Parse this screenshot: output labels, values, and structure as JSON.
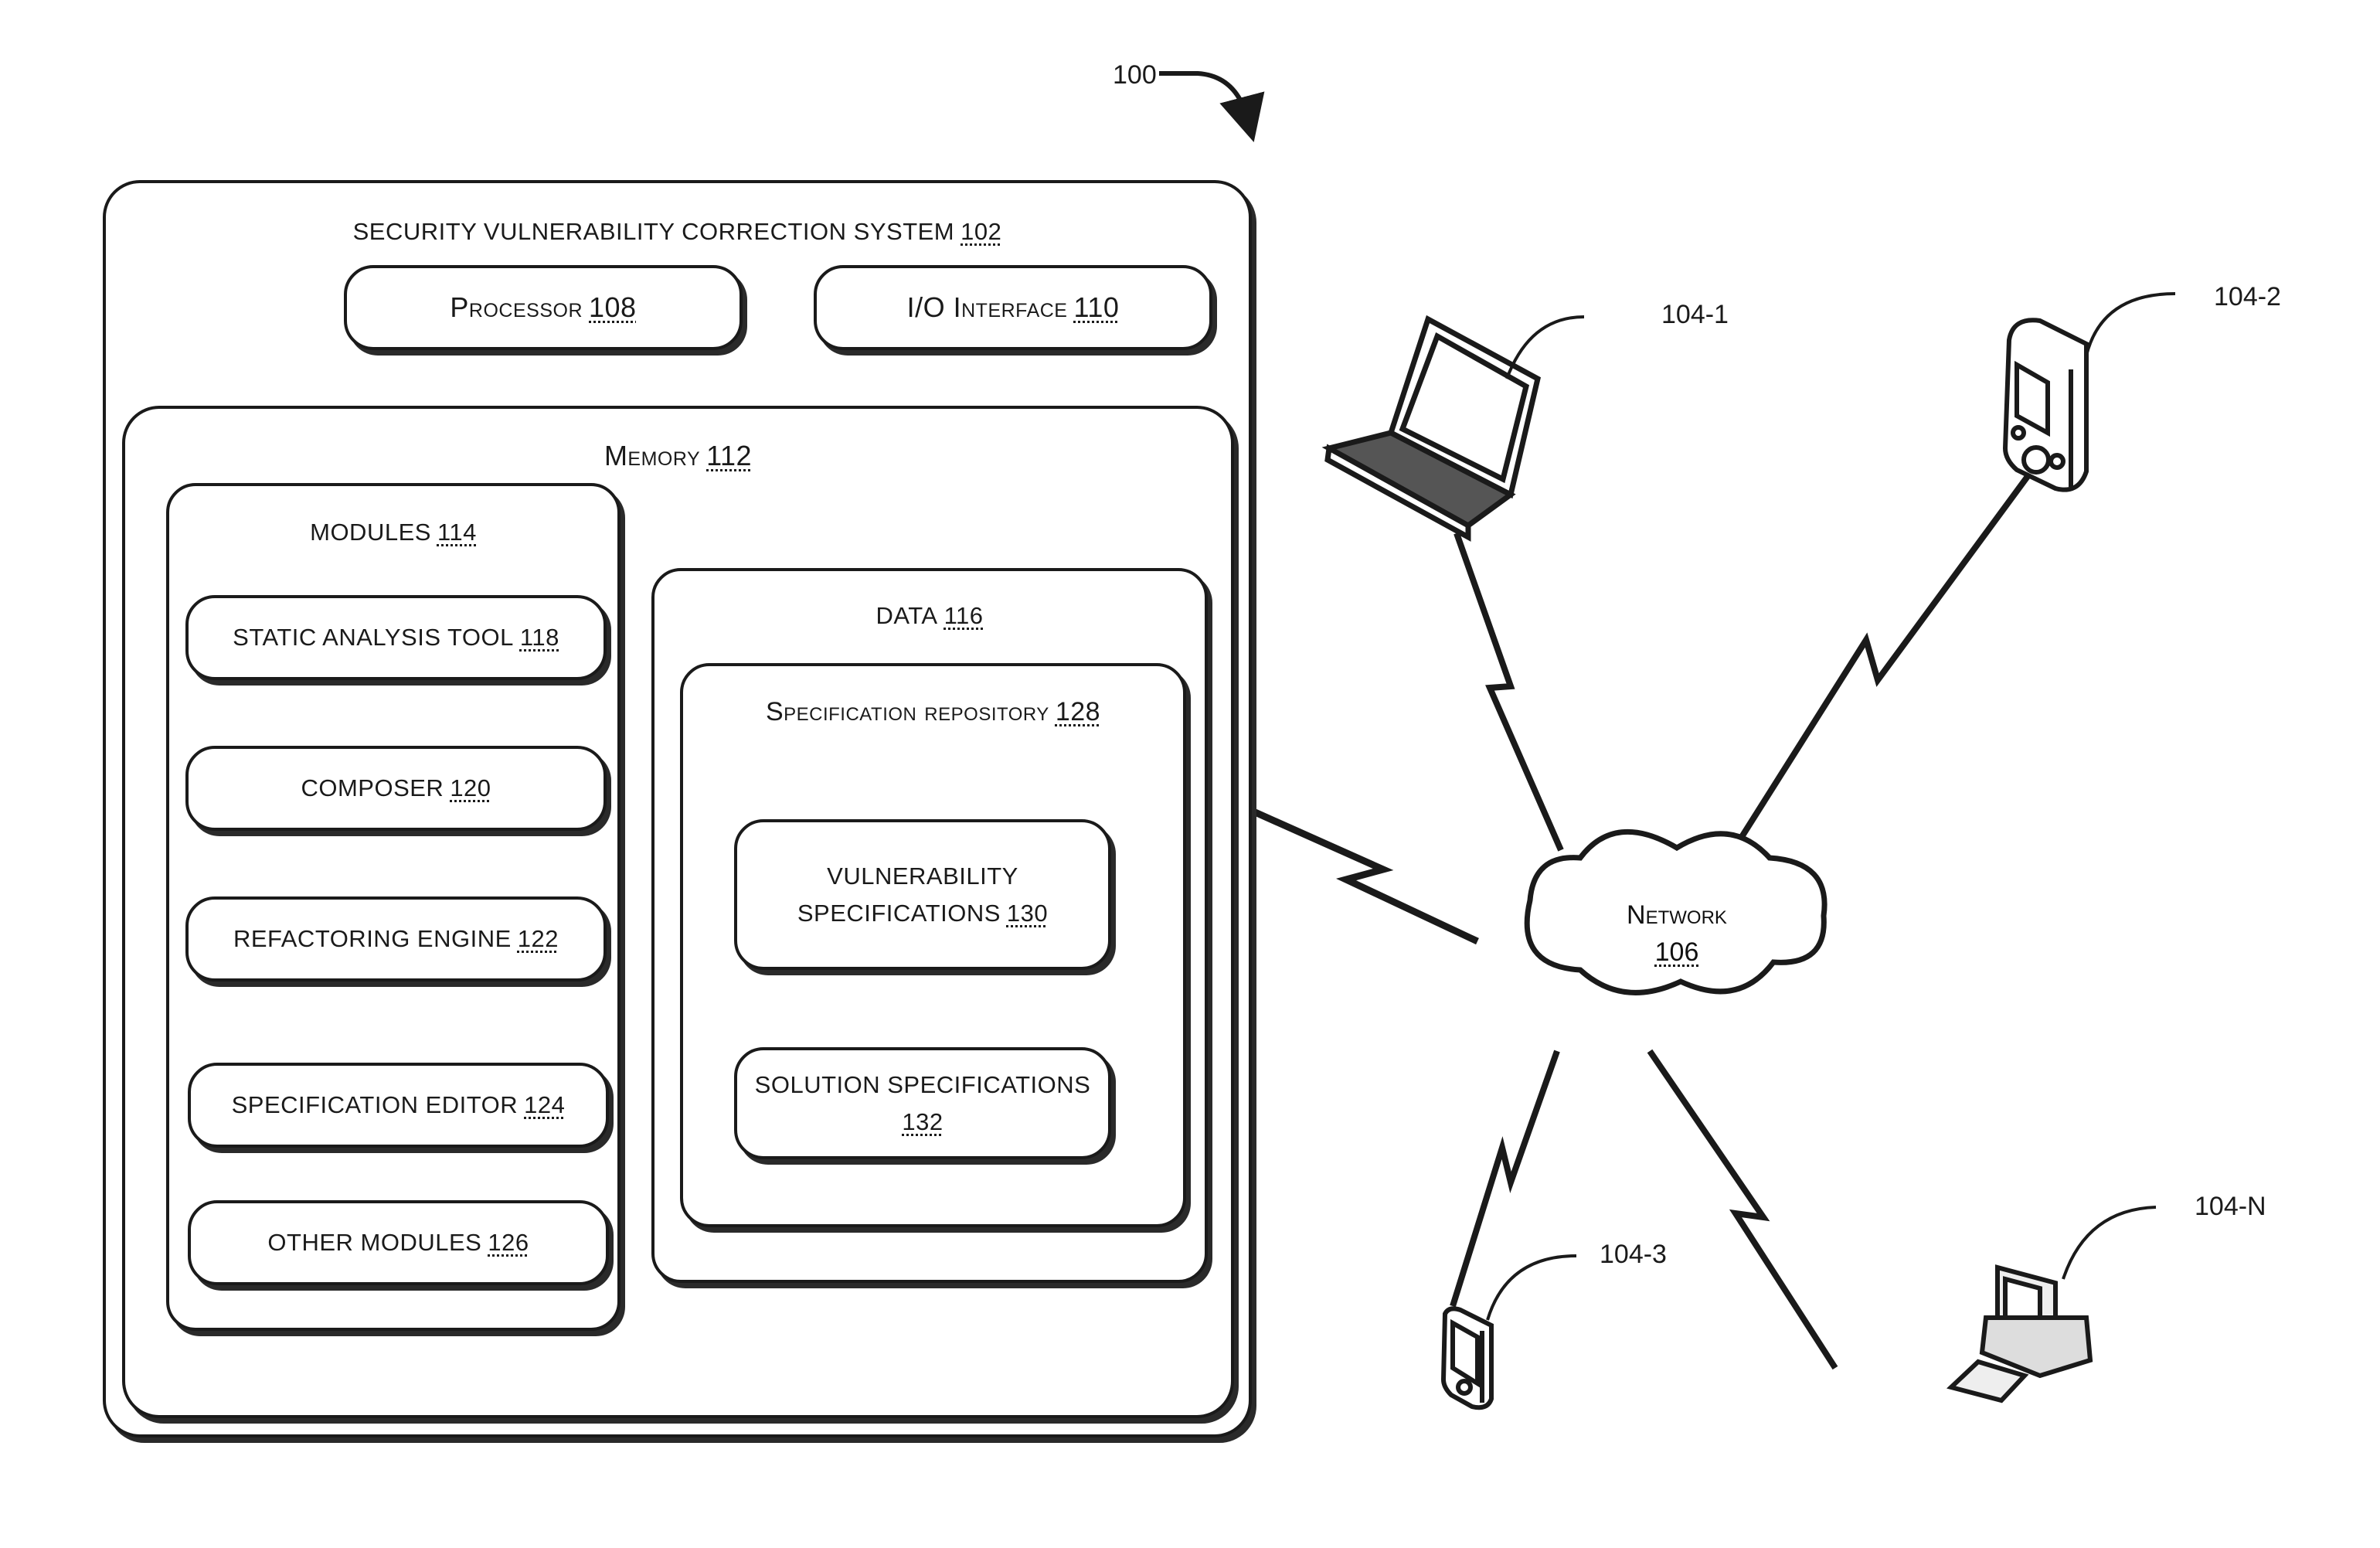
{
  "figure": {
    "ref_number": "100"
  },
  "system": {
    "title": "SECURITY VULNERABILITY CORRECTION SYSTEM",
    "ref": "102",
    "processor": {
      "label": "Processor",
      "ref": "108"
    },
    "io_interface": {
      "label": "I/O Interface",
      "ref": "110"
    },
    "memory": {
      "label": "Memory",
      "ref": "112",
      "modules": {
        "label": "MODULES",
        "ref": "114",
        "items": [
          {
            "label": "STATIC ANALYSIS TOOL",
            "ref": "118"
          },
          {
            "label": "COMPOSER",
            "ref": "120"
          },
          {
            "label": "REFACTORING ENGINE",
            "ref": "122"
          },
          {
            "label": "SPECIFICATION EDITOR",
            "ref": "124"
          },
          {
            "label": "OTHER MODULES",
            "ref": "126"
          }
        ]
      },
      "data": {
        "label": "DATA",
        "ref": "116",
        "repository": {
          "label": "Specification repository",
          "ref": "128",
          "items": [
            {
              "line1": "VULNERABILITY",
              "line2": "SPECIFICATIONS",
              "ref": "130"
            },
            {
              "line1": "SOLUTION SPECIFICATIONS",
              "line2": "",
              "ref": "132"
            }
          ]
        }
      }
    }
  },
  "network": {
    "label": "Network",
    "ref": "106"
  },
  "devices": [
    {
      "type": "laptop",
      "ref": "104-1"
    },
    {
      "type": "pda",
      "ref": "104-2"
    },
    {
      "type": "smartphone",
      "ref": "104-3"
    },
    {
      "type": "desktop",
      "ref": "104-N"
    }
  ]
}
